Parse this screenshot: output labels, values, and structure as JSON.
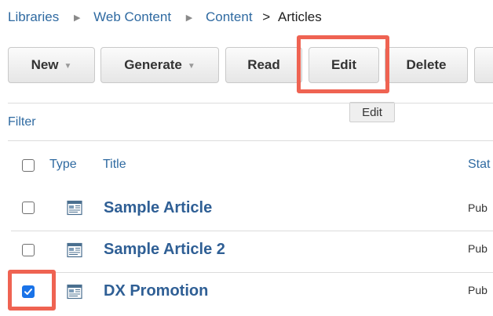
{
  "breadcrumb": {
    "items": [
      "Libraries",
      "Web Content",
      "Content"
    ],
    "separator": "▶",
    "gt": ">",
    "current": "Articles"
  },
  "toolbar": {
    "new_label": "New",
    "generate_label": "Generate",
    "read_label": "Read",
    "edit_label": "Edit",
    "delete_label": "Delete",
    "caret": "▼"
  },
  "tooltip": {
    "text": "Edit"
  },
  "filter": {
    "label": "Filter"
  },
  "table": {
    "headers": {
      "type": "Type",
      "title": "Title",
      "status": "Stat"
    },
    "rows": [
      {
        "title": "Sample Article",
        "status": "Pub",
        "checked": false,
        "icon": "web-content-document-icon"
      },
      {
        "title": "Sample Article 2",
        "status": "Pub",
        "checked": false,
        "icon": "web-content-document-icon"
      },
      {
        "title": "DX Promotion",
        "status": "Pub",
        "checked": true,
        "icon": "web-content-document-icon"
      }
    ]
  },
  "colors": {
    "link": "#2f6aa1",
    "highlight": "#ef6352",
    "checkbox_checked": "#1a73e8"
  }
}
